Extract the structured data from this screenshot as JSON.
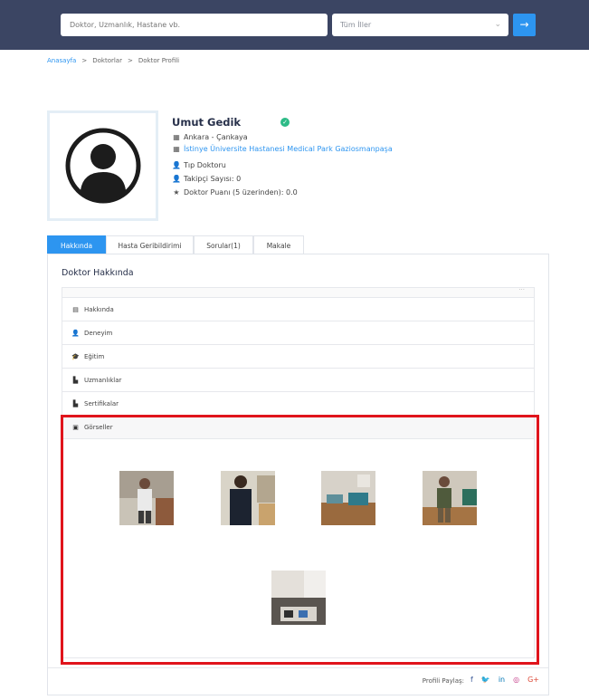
{
  "header": {
    "search_placeholder": "Doktor, Uzmanlık, Hastane vb.",
    "city_select": "Tüm İller",
    "search_button_icon": "arrow-right-icon"
  },
  "breadcrumb": [
    "Anasayfa",
    "Doktorlar",
    "Doktor Profili"
  ],
  "profile": {
    "name": "Umut Gedik",
    "location": "Ankara - Çankaya",
    "hospital": "İstinye Üniversite Hastanesi Medical Park Gaziosmanpaşa",
    "title": "Tıp Doktoru",
    "followers": "Takipçi Sayısı: 0",
    "rating": "Doktor Puanı (5 üzerinden): 0.0"
  },
  "tabs": [
    "Hakkında",
    "Hasta Geribildirimi",
    "Sorular(1)",
    "Makale"
  ],
  "panel_title": "Doktor Hakkında",
  "accordion": [
    "Hakkında",
    "Deneyim",
    "Eğitim",
    "Uzmanlıklar",
    "Sertifikalar",
    "Görseller"
  ],
  "share": {
    "label": "Profili Paylaş:"
  },
  "colors": {
    "header": "#3b4563",
    "accent": "#2d95f0",
    "verified": "#2dbb87",
    "highlight": "#e0141c"
  }
}
